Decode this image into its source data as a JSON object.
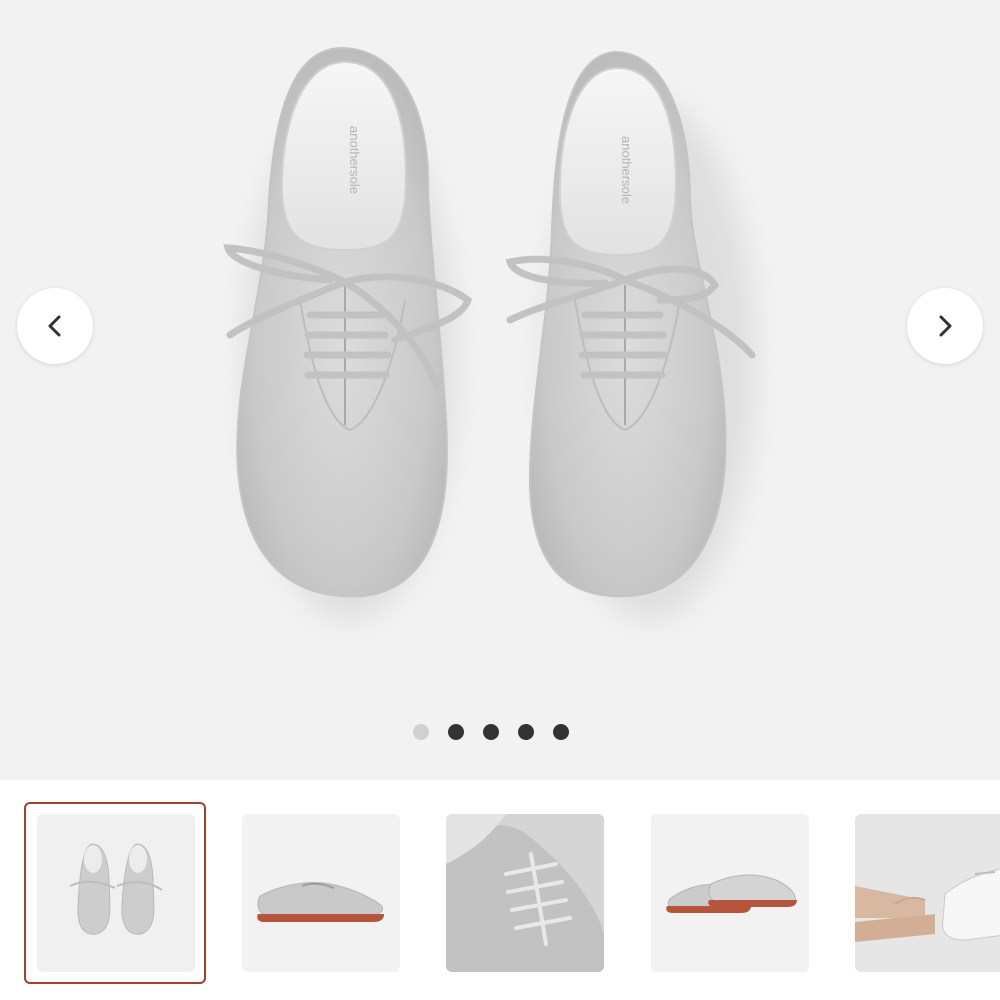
{
  "gallery": {
    "brand_insole_text": "anothersole",
    "prev_icon": "chevron-left-icon",
    "next_icon": "chevron-right-icon",
    "slide_count": 5,
    "active_slide": 1,
    "accent_color": "#a0412b",
    "thumbnails": [
      {
        "view": "top-down pair",
        "selected": true
      },
      {
        "view": "side profile",
        "selected": false
      },
      {
        "view": "lace close-up",
        "selected": false
      },
      {
        "view": "three-quarter pair",
        "selected": false
      },
      {
        "view": "worn on feet",
        "selected": false
      }
    ]
  }
}
